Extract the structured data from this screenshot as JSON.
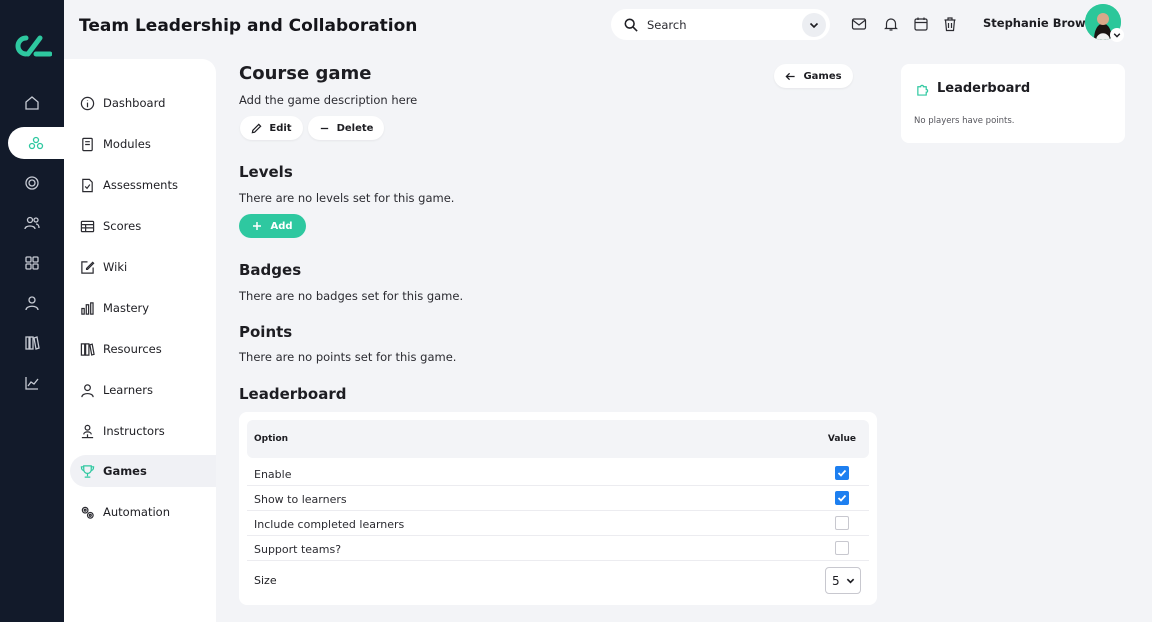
{
  "header": {
    "title": "Team Leadership and Collaboration",
    "search_placeholder": "Search",
    "user_name": "Stephanie Brown",
    "icons": [
      "mail-icon",
      "bell-icon",
      "calendar-icon",
      "trash-icon"
    ]
  },
  "rail": {
    "icons": [
      "home-icon",
      "course-icon",
      "target-icon",
      "people-icon",
      "grid-icon",
      "person-icon",
      "library-icon",
      "chart-icon"
    ],
    "active": "course-icon"
  },
  "sidebar": {
    "items": [
      {
        "label": "Dashboard",
        "icon": "info-icon"
      },
      {
        "label": "Modules",
        "icon": "book-icon"
      },
      {
        "label": "Assessments",
        "icon": "document-check-icon"
      },
      {
        "label": "Scores",
        "icon": "table-icon"
      },
      {
        "label": "Wiki",
        "icon": "edit-icon"
      },
      {
        "label": "Mastery",
        "icon": "bar-chart-icon"
      },
      {
        "label": "Resources",
        "icon": "library-icon"
      },
      {
        "label": "Learners",
        "icon": "person-icon"
      },
      {
        "label": "Instructors",
        "icon": "instructor-icon"
      },
      {
        "label": "Games",
        "icon": "trophy-icon"
      },
      {
        "label": "Automation",
        "icon": "gears-icon"
      }
    ],
    "active": "Games"
  },
  "main": {
    "title": "Course game",
    "description": "Add the game description here",
    "edit_label": "Edit",
    "delete_label": "Delete",
    "back_label": "Games",
    "levels": {
      "heading": "Levels",
      "empty": "There are no levels set for this game.",
      "add_label": "Add"
    },
    "badges": {
      "heading": "Badges",
      "empty": "There are no badges set for this game."
    },
    "points": {
      "heading": "Points",
      "empty": "There are no points set for this game."
    },
    "leaderboard": {
      "heading": "Leaderboard",
      "col_option": "Option",
      "col_value": "Value",
      "rows": [
        {
          "label": "Enable",
          "checked": true
        },
        {
          "label": "Show to learners",
          "checked": true
        },
        {
          "label": "Include completed learners",
          "checked": false
        },
        {
          "label": "Support teams?",
          "checked": false
        }
      ],
      "size_label": "Size",
      "size_value": "5"
    }
  },
  "right_panel": {
    "title": "Leaderboard",
    "empty": "No players have points."
  },
  "colors": {
    "rail_bg": "#121a2a",
    "accent": "#2ec8a0",
    "checkbox": "#1d7ff0"
  }
}
